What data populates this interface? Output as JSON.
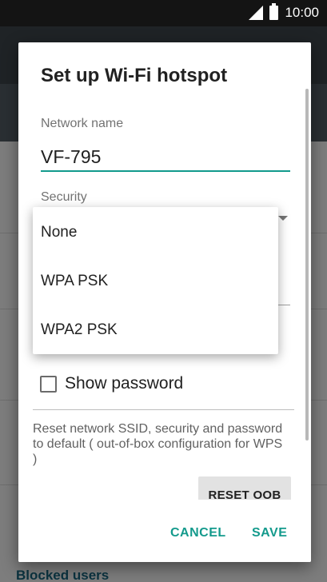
{
  "status_bar": {
    "time": "10:00"
  },
  "background": {
    "bottom_label": "Blocked users"
  },
  "dialog": {
    "title": "Set up Wi-Fi hotspot",
    "network_name_label": "Network name",
    "network_name_value": "VF-795",
    "security_label": "Security",
    "security_options": [
      "None",
      "WPA PSK",
      "WPA2 PSK"
    ],
    "show_password_label": "Show password",
    "description": "Reset network SSID, security and password to default ( out-of-box configuration for WPS )",
    "reset_button": "RESET OOB",
    "cancel_button": "CANCEL",
    "save_button": "SAVE"
  },
  "colors": {
    "accent": "#129a8c"
  }
}
